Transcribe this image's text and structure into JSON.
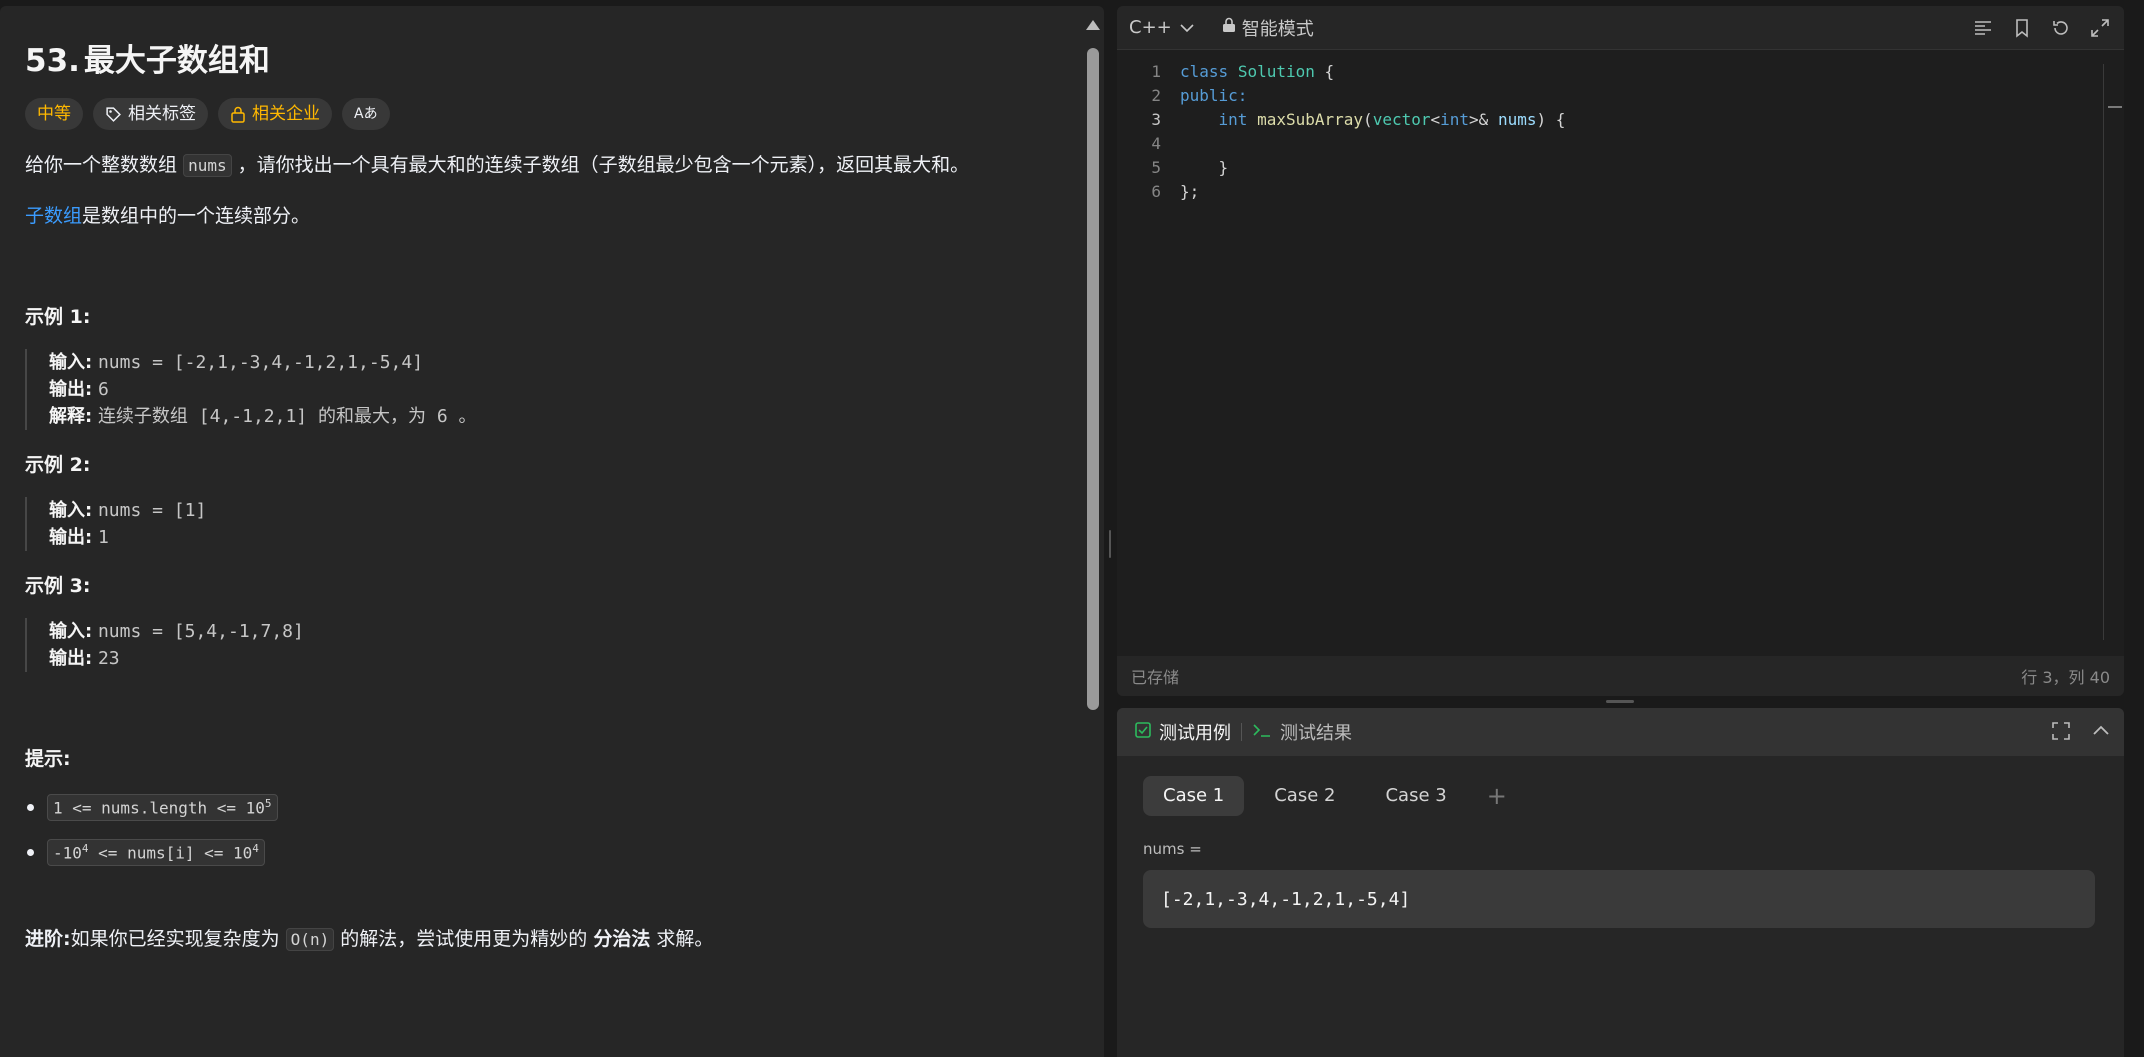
{
  "problem": {
    "number": "53.",
    "title": "最大子数组和",
    "difficulty": "中等",
    "tag_label": "相关标签",
    "company_label": "相关企业",
    "translate_icon_text": "Aあ",
    "desc_pre": "给你一个整数数组",
    "desc_code": "nums",
    "desc_post": "，请你找出一个具有最大和的连续子数组（子数组最少包含一个元素），返回其最大和。",
    "subarray_link": "子数组",
    "subarray_def": "是数组中的一个连续部分。",
    "examples": [
      {
        "title": "示例 1:",
        "input_label": "输入:",
        "input": "nums = [-2,1,-3,4,-1,2,1,-5,4]",
        "output_label": "输出:",
        "output": "6",
        "explain_label": "解释:",
        "explain": "连续子数组 [4,-1,2,1] 的和最大，为 6 。"
      },
      {
        "title": "示例 2:",
        "input_label": "输入:",
        "input": "nums = [1]",
        "output_label": "输出:",
        "output": "1"
      },
      {
        "title": "示例 3:",
        "input_label": "输入:",
        "input": "nums = [5,4,-1,7,8]",
        "output_label": "输出:",
        "output": "23"
      }
    ],
    "hints_title": "提示:",
    "hint1_pre": "1 <= nums.length <= 10",
    "hint1_sup": "5",
    "hint2_pre": "-10",
    "hint2_sup1": "4",
    "hint2_mid": " <= nums[i] <= 10",
    "hint2_sup2": "4",
    "advanced_label": "进阶:",
    "advanced_pre": "如果你已经实现复杂度为",
    "advanced_code": "O(n)",
    "advanced_mid": "的解法，尝试使用更为精妙的",
    "advanced_bold": "分治法",
    "advanced_post": "求解。"
  },
  "editor": {
    "language": "C++",
    "mode": "智能模式",
    "saved": "已存储",
    "cursor": "行 3，列 40",
    "line_numbers": [
      "1",
      "2",
      "3",
      "4",
      "5",
      "6"
    ],
    "code": {
      "l1_kw": "class",
      "l1_name": "Solution",
      "l1_rest": " {",
      "l2": "public:",
      "l3_indent": "    ",
      "l3_int": "int",
      "l3_fn": "maxSubArray",
      "l3_p1": "(",
      "l3_vec": "vector",
      "l3_lt": "<",
      "l3_int2": "int",
      "l3_gt": ">& ",
      "l3_param": "nums",
      "l3_end": ") {",
      "l5": "    }",
      "l6": "};"
    }
  },
  "tests": {
    "tab_cases": "测试用例",
    "tab_results": "测试结果",
    "cases": [
      "Case 1",
      "Case 2",
      "Case 3"
    ],
    "add": "+",
    "param_label": "nums =",
    "param_value": "[-2,1,-3,4,-1,2,1,-5,4]"
  },
  "colors": {
    "accent_blue": "#3b9cff",
    "difficulty": "#ffb800",
    "success_green": "#2cbb5d"
  }
}
